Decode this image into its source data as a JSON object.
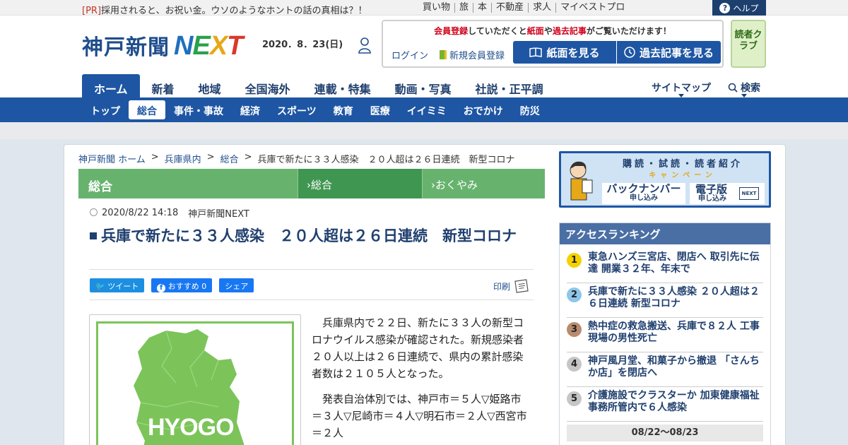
{
  "topbar": {
    "pr_tag": "[PR]",
    "pr_text": "採用されると、お祝い金。ウソのようなホントの話の真相は？！",
    "links": [
      "買い物",
      "旅",
      "本",
      "不動産",
      "求人",
      "マイベストプロ"
    ],
    "help": "ヘルプ"
  },
  "header": {
    "logo_kobe": "神戸新聞",
    "logo_next": [
      "N",
      "E",
      "X",
      "T"
    ],
    "date": "2020．8．23(日)",
    "member_msg_1": "会員登録",
    "member_msg_2": "していただくと",
    "member_msg_3": "紙面",
    "member_msg_4": "や",
    "member_msg_5": "過去記事",
    "member_msg_6": "がご覧いただけます！",
    "login": "ログイン",
    "register": "新規会員登録",
    "btn_paper": "紙面を見る",
    "btn_archive": "過去記事を見る",
    "dokusha": "読者クラブ"
  },
  "mainnav": {
    "items": [
      "ホーム",
      "新着",
      "地域",
      "全国海外",
      "連載・特集",
      "動画・写真",
      "社説・正平調"
    ],
    "sitemap": "サイトマップ",
    "search": "検索"
  },
  "subnav": {
    "items": [
      "トップ",
      "総合",
      "事件・事故",
      "経済",
      "スポーツ",
      "教育",
      "医療",
      "イイミミ",
      "おでかけ",
      "防災"
    ]
  },
  "breadcrumb": [
    "神戸新聞 ホーム",
    "兵庫県内",
    "総合",
    "兵庫で新たに３３人感染　２０人超は２６日連続　新型コロナ"
  ],
  "category": {
    "title": "総合",
    "tab1": "総合",
    "tab2": "おくやみ"
  },
  "article": {
    "datetime": "2020/8/22 14:18",
    "source": "神戸新聞NEXT",
    "headline": "兵庫で新たに３３人感染　２０人超は２６日連続　新型コロナ",
    "tweet": "ツイート",
    "fb_like": "おすすめ 0",
    "share": "シェア",
    "print": "印刷",
    "image_label": "HYOGO",
    "para1": "兵庫県内で２２日、新たに３３人の新型コロナウイルス感染が確認された。新規感染者２０人以上は２６日連続で、県内の累計感染者数は２１０５人となった。",
    "para2": "発表自治体別では、神戸市＝５人▽姫路市＝３人▽尼崎市＝４人▽明石市＝２人▽西宮市＝２人"
  },
  "banner": {
    "line1": "購読・試読・読者紹介",
    "line2": "キャンペーン",
    "backnumber": "バックナンバー",
    "backnumber_sub": "申し込み",
    "denshi": "電子版",
    "denshi_sub": "申し込み",
    "next_logo": "NEXT"
  },
  "ranking": {
    "title": "アクセスランキング",
    "items": [
      {
        "n": "1",
        "text": "東急ハンズ三宮店、閉店へ 取引先に伝達 開業３２年、年末で"
      },
      {
        "n": "2",
        "text": "兵庫で新たに３３人感染 ２０人超は２６日連続 新型コロナ"
      },
      {
        "n": "3",
        "text": "熱中症の救急搬送、兵庫で８２人 工事現場の男性死亡"
      },
      {
        "n": "4",
        "text": "神戸風月堂、和菓子から撤退 「さんちか店」を閉店へ"
      },
      {
        "n": "5",
        "text": "介護施設でクラスターか 加東健康福祉事務所管内で６人感染"
      }
    ],
    "period": "08/22～08/23"
  }
}
